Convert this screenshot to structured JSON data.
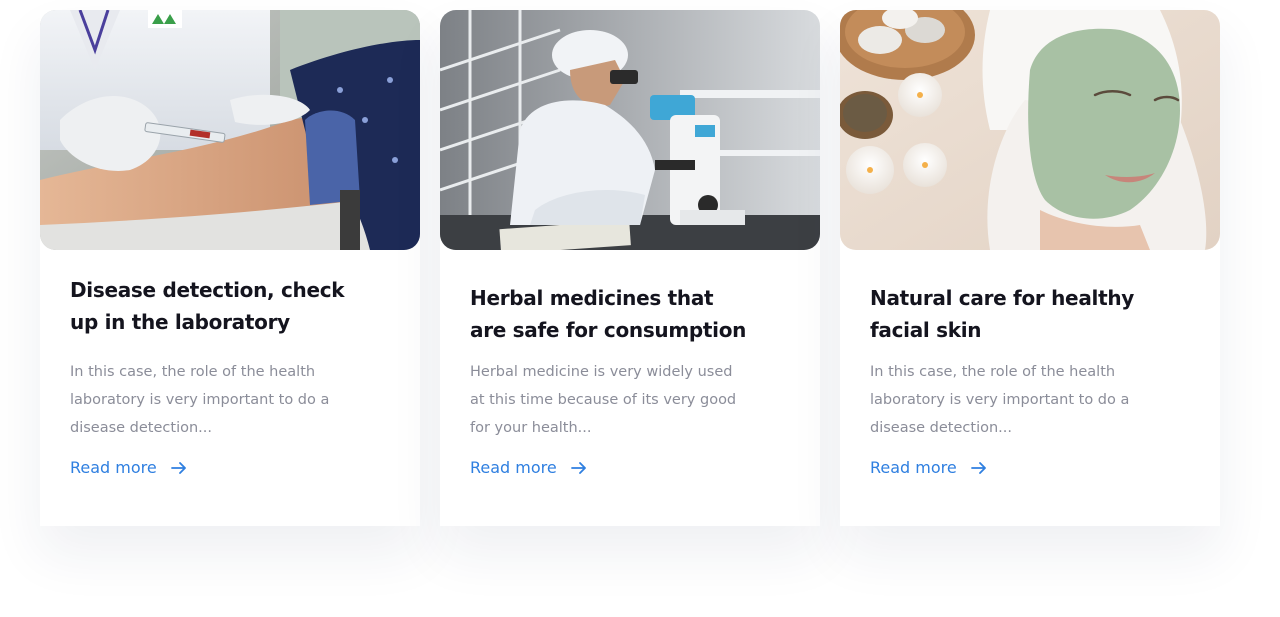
{
  "cards": [
    {
      "title": "Disease detection, check up in the laboratory",
      "text": "In this case, the role of the health laboratory is very important to do a disease detection...",
      "link_label": "Read more",
      "image": "blood-draw-photo"
    },
    {
      "title": "Herbal medicines that are safe for consumption",
      "text": "Herbal medicine is very widely used at this time because of its very good for your health...",
      "link_label": "Read more",
      "image": "microscope-researcher-photo"
    },
    {
      "title": "Natural care for healthy facial skin",
      "text": "In this case, the role of the health laboratory is very important to do a disease detection...",
      "link_label": "Read more",
      "image": "facial-mask-spa-photo"
    }
  ],
  "colors": {
    "link": "#2f7fe0",
    "title": "#14141e",
    "body_text": "#8b8d99"
  },
  "icons": {
    "link_arrow": "arrow-right-icon"
  }
}
